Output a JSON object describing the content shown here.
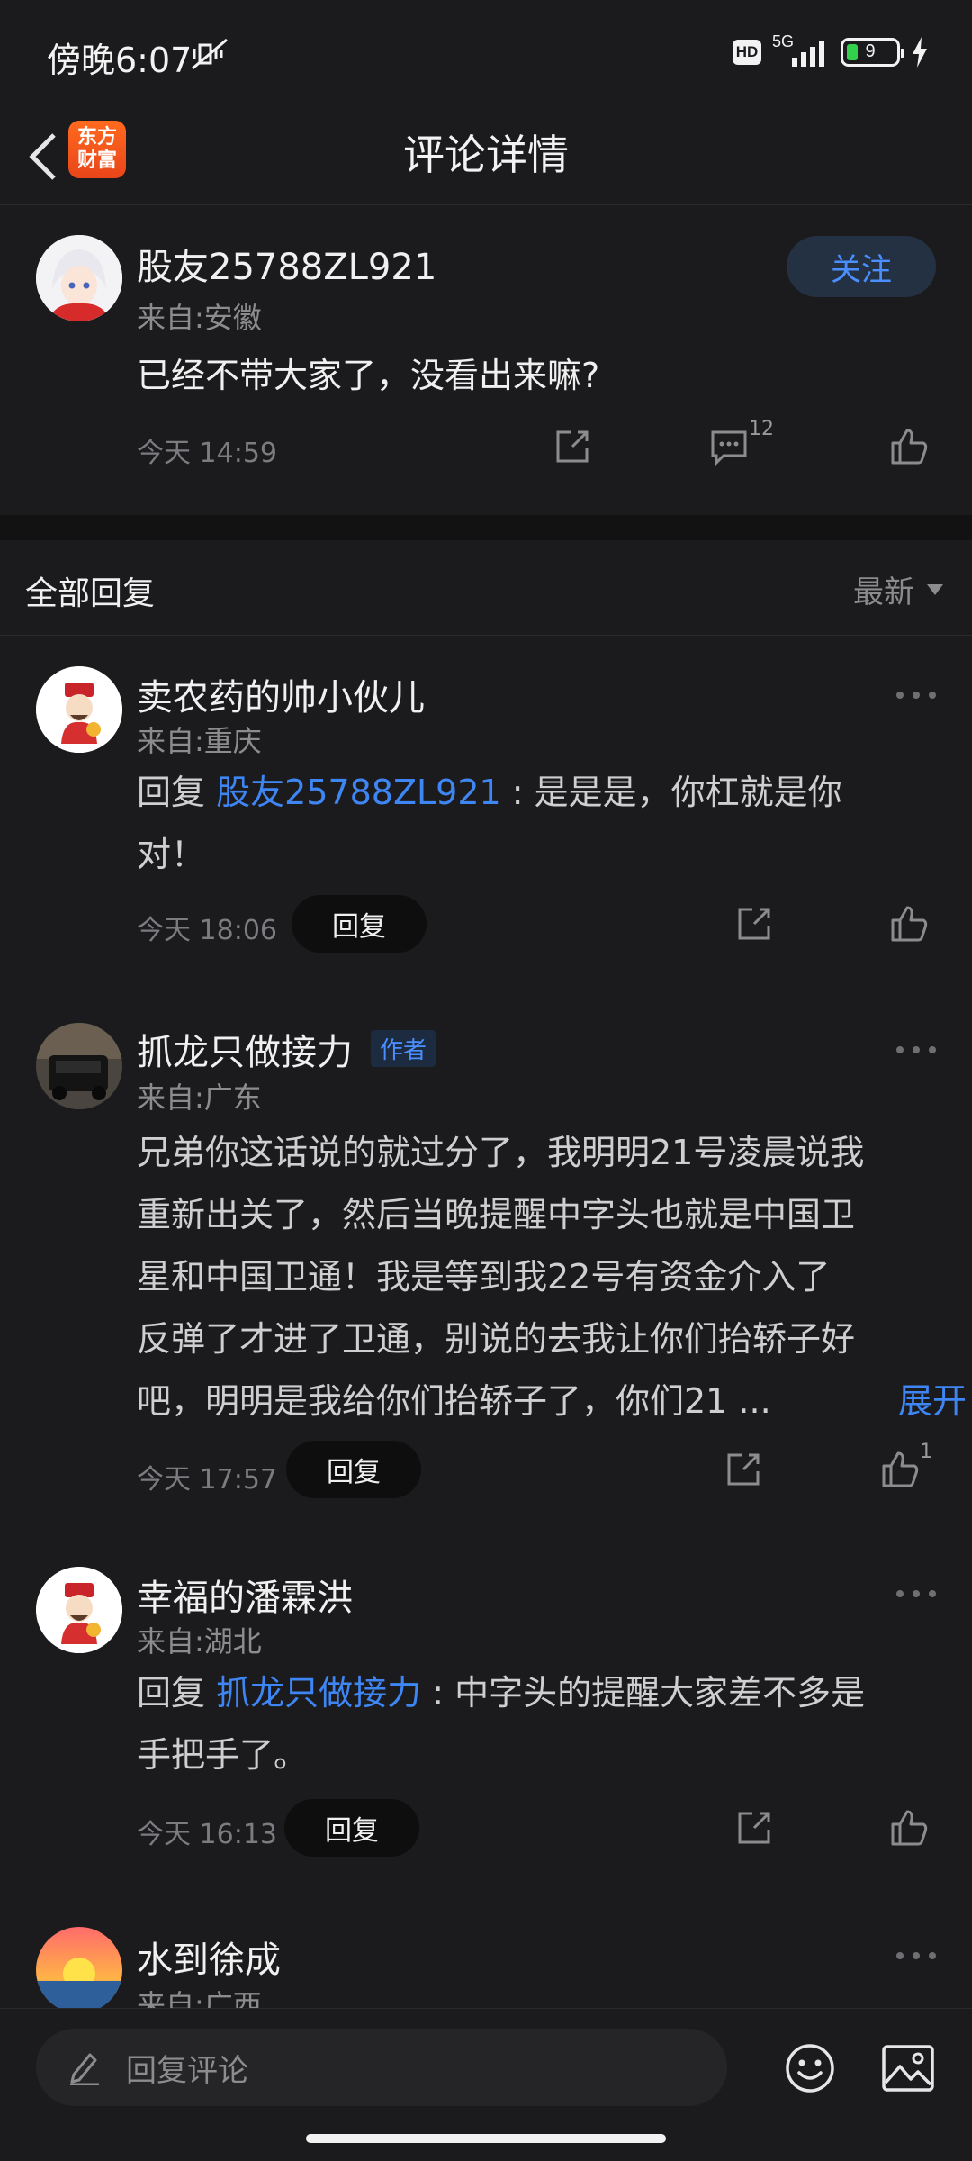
{
  "status_bar": {
    "time": "傍晚6:07",
    "hd": "HD",
    "network": "5G",
    "battery": "9"
  },
  "nav": {
    "title": "评论详情",
    "logo_text": "东方财富",
    "icons": [
      "back-arrow-icon",
      "app-logo-icon"
    ]
  },
  "post": {
    "username": "股友25788ZL921",
    "location": "来自:安徽",
    "follow_label": "关注",
    "text": "已经不带大家了，没看出来嘛?",
    "time": "今天 14:59",
    "comment_count": "12",
    "icons": [
      "share-icon",
      "comment-icon",
      "like-icon"
    ]
  },
  "replies_header": {
    "title": "全部回复",
    "sort_label": "最新"
  },
  "replies": [
    {
      "username": "卖农药的帅小伙儿",
      "location": "来自:重庆",
      "reply_prefix": "回复 ",
      "mention": "股友25788ZL921",
      "text_line1": " : 是是是，你杠就是你",
      "text_line2": "对！",
      "time": "今天 18:06",
      "reply_label": "回复"
    },
    {
      "username": "抓龙只做接力",
      "badge": "作者",
      "location": "来自:广东",
      "lines": [
        "兄弟你这话说的就过分了，我明明21号凌晨说我",
        "重新出关了，然后当晚提醒中字头也就是中国卫",
        "星和中国卫通！我是等到我22号有资金介入了",
        "反弹了才进了卫通，别说的去我让你们抬轿子好",
        "吧，明明是我给你们抬轿子了，你们21 ..."
      ],
      "expand_label": "展开",
      "time": "今天 17:57",
      "reply_label": "回复",
      "like_count": "1"
    },
    {
      "username": "幸福的潘霖洪",
      "location": "来自:湖北",
      "reply_prefix": "回复 ",
      "mention": "抓龙只做接力",
      "text_line1": " : 中字头的提醒大家差不多是",
      "text_line2": "手把手了。",
      "time": "今天 16:13",
      "reply_label": "回复"
    },
    {
      "username": "水到徐成",
      "location": "来自:广西"
    }
  ],
  "bottom_bar": {
    "placeholder": "回复评论",
    "icons": [
      "pencil-icon",
      "emoji-icon",
      "image-icon"
    ]
  }
}
